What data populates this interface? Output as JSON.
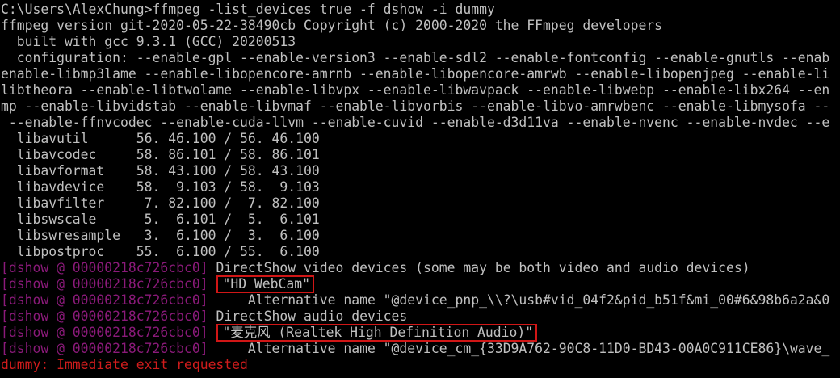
{
  "terminal": {
    "lines": [
      {
        "text": "C:\\Users\\AlexChung>ffmpeg -list_devices true -f dshow -i dummy"
      },
      {
        "text": "ffmpeg version git-2020-05-22-38490cb Copyright (c) 2000-2020 the FFmpeg developers"
      },
      {
        "text": "  built with gcc 9.3.1 (GCC) 20200513"
      },
      {
        "text": "  configuration: --enable-gpl --enable-version3 --enable-sdl2 --enable-fontconfig --enable-gnutls --enab"
      },
      {
        "text": "enable-libmp3lame --enable-libopencore-amrnb --enable-libopencore-amrwb --enable-libopenjpeg --enable-li"
      },
      {
        "text": "libtheora --enable-libtwolame --enable-libvpx --enable-libwavpack --enable-libwebp --enable-libx264 --en"
      },
      {
        "text": "mp --enable-libvidstab --enable-libvmaf --enable-libvorbis --enable-libvo-amrwbenc --enable-libmysofa --"
      },
      {
        "text": " --enable-ffnvcodec --enable-cuda-llvm --enable-cuvid --enable-d3d11va --enable-nvenc --enable-nvdec --e"
      },
      {
        "text": "  libavutil      56. 46.100 / 56. 46.100"
      },
      {
        "text": "  libavcodec     58. 86.101 / 58. 86.101"
      },
      {
        "text": "  libavformat    58. 43.100 / 58. 43.100"
      },
      {
        "text": "  libavdevice    58.  9.103 / 58.  9.103"
      },
      {
        "text": "  libavfilter     7. 82.100 /  7. 82.100"
      },
      {
        "text": "  libswscale      5.  6.101 /  5.  6.101"
      },
      {
        "text": "  libswresample   3.  6.100 /  3.  6.100"
      },
      {
        "text": "  libpostproc    55.  6.100 / 55.  6.100"
      },
      {
        "prefix": "[dshow @ 00000218c726cbc0]",
        "text": " DirectShow video devices (some may be both video and audio devices)"
      },
      {
        "prefix": "[dshow @ 00000218c726cbc0]",
        "text": " ",
        "boxed": "\"HD WebCam\""
      },
      {
        "prefix": "[dshow @ 00000218c726cbc0]",
        "text": "     Alternative name \"@device_pnp_\\\\?\\usb#vid_04f2&pid_b51f&mi_00#6&98b6a2a&0"
      },
      {
        "prefix": "[dshow @ 00000218c726cbc0]",
        "text": " DirectShow audio devices"
      },
      {
        "prefix": "[dshow @ 00000218c726cbc0]",
        "text": " ",
        "boxed": "\"麦克风 (Realtek High Definition Audio)\""
      },
      {
        "prefix": "[dshow @ 00000218c726cbc0]",
        "text": "     Alternative name \"@device_cm_{33D9A762-90C8-11D0-BD43-00A0C911CE86}\\wave_"
      },
      {
        "error": "dummy: Immediate exit requested"
      }
    ]
  }
}
